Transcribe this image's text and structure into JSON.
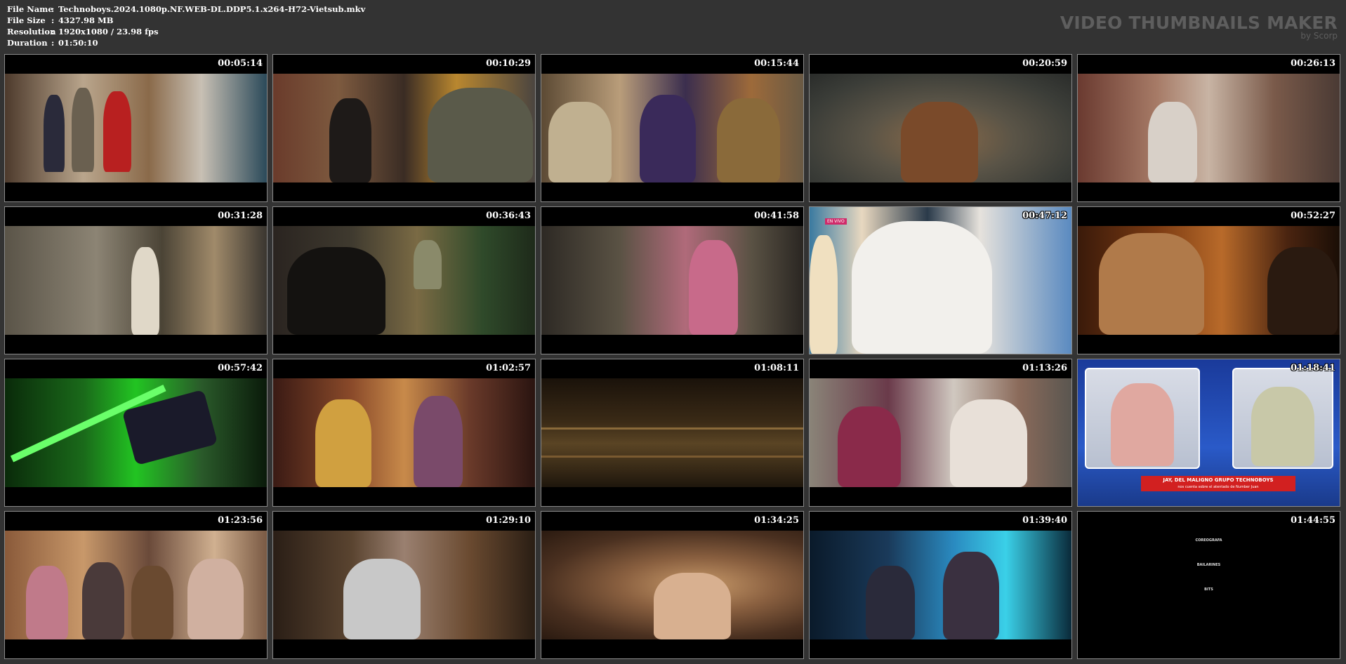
{
  "header": {
    "file_name_label": "File Name",
    "file_name": "Technoboys.2024.1080p.NF.WEB-DL.DDP5.1.x264-H72-Vietsub.mkv",
    "file_size_label": "File Size",
    "file_size": "4327.98 MB",
    "resolution_label": "Resolution",
    "resolution": "1920x1080 / 23.98 fps",
    "duration_label": "Duration",
    "duration": "01:50:10",
    "colon": ":"
  },
  "brand": {
    "title": "VIDEO THUMBNAILS MAKER",
    "subtitle": "by Scorp"
  },
  "thumbnails": [
    {
      "time": "00:05:14"
    },
    {
      "time": "00:10:29"
    },
    {
      "time": "00:15:44"
    },
    {
      "time": "00:20:59"
    },
    {
      "time": "00:26:13"
    },
    {
      "time": "00:31:28"
    },
    {
      "time": "00:36:43"
    },
    {
      "time": "00:41:58"
    },
    {
      "time": "00:47:12",
      "overlay": "EN VIVO"
    },
    {
      "time": "00:52:27"
    },
    {
      "time": "00:57:42"
    },
    {
      "time": "01:02:57"
    },
    {
      "time": "01:08:11"
    },
    {
      "time": "01:13:26"
    },
    {
      "time": "01:18:41",
      "news_title": "JAY, DEL MALIGNO GRUPO TECHNOBOYS",
      "news_sub": "nos cuenta sobre el atentado de Number Juan"
    },
    {
      "time": "01:23:56"
    },
    {
      "time": "01:29:10"
    },
    {
      "time": "01:34:25"
    },
    {
      "time": "01:39:40"
    },
    {
      "time": "01:44:55",
      "credits_h1": "COREOGRAFA",
      "credits_h2": "BAILARINES",
      "credits_h3": "BITS"
    }
  ]
}
